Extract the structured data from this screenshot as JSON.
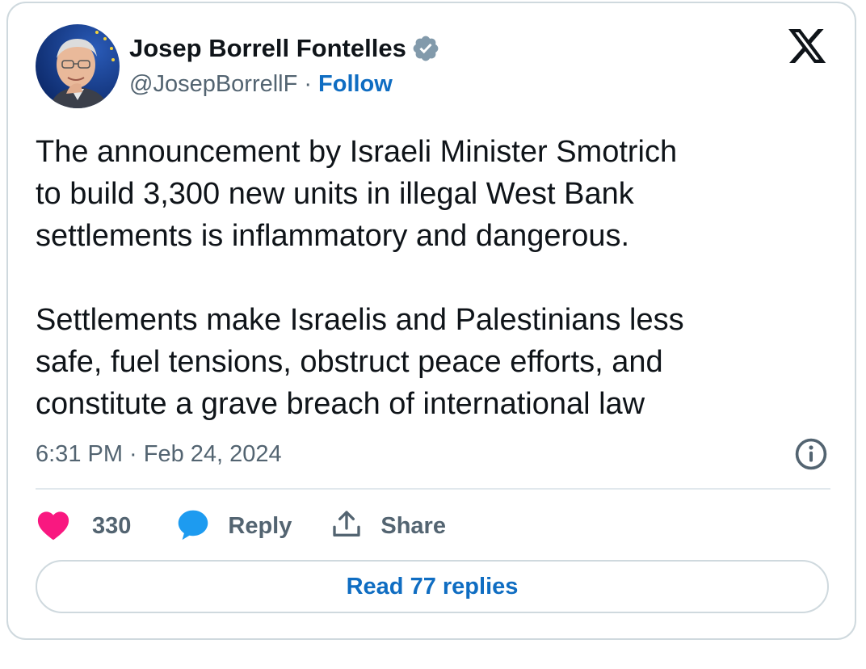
{
  "author": {
    "display_name": "Josep Borrell Fontelles",
    "handle": "@JosepBorrellF",
    "separator": "·",
    "follow_label": "Follow",
    "verified_icon": "verified-badge-icon",
    "avatar": "author-avatar-photo"
  },
  "platform_logo": "x-logo-icon",
  "tweet": {
    "paragraphs": [
      [
        "The announcement by Israeli Minister Smotrich",
        "to build 3,300 new units in illegal West Bank",
        "settlements is inflammatory and dangerous."
      ],
      [
        "Settlements make Israelis and Palestinians less",
        "safe, fuel tensions, obstruct peace efforts, and",
        "constitute a grave breach of international law"
      ]
    ],
    "timestamp": "6:31 PM · Feb 24, 2024"
  },
  "actions": {
    "like_count": "330",
    "reply_label": "Reply",
    "share_label": "Share"
  },
  "read_replies_label": "Read 77 replies",
  "colors": {
    "like": "#f91880",
    "reply": "#1d9bf0",
    "link": "#0f6dc2",
    "muted": "#536471",
    "verified_badge": "#829aab",
    "border": "#cfd9de"
  }
}
